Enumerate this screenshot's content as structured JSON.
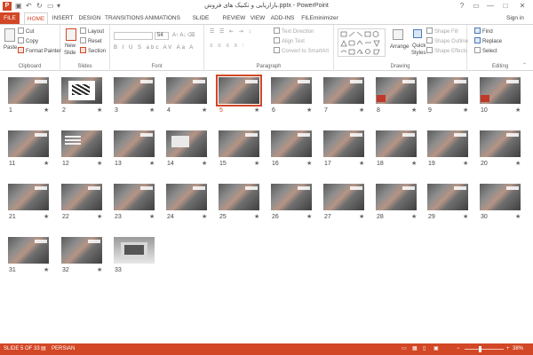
{
  "window": {
    "title": "بازاریابی و تکنیک های فروش.pptx - PowerPoint",
    "app_letter": "P",
    "qat": [
      "save-icon",
      "undo-icon",
      "redo-icon",
      "slideshow-icon",
      "customize-icon"
    ],
    "controls": [
      "?",
      "▭",
      "—",
      "□",
      "✕"
    ]
  },
  "tabs": [
    {
      "label": "FILE"
    },
    {
      "label": "HOME"
    },
    {
      "label": "INSERT"
    },
    {
      "label": "DESIGN"
    },
    {
      "label": "TRANSITIONS"
    },
    {
      "label": "ANIMATIONS"
    },
    {
      "label": "SLIDE SHOW"
    },
    {
      "label": "REVIEW"
    },
    {
      "label": "VIEW"
    },
    {
      "label": "ADD-INS"
    },
    {
      "label": "FILEminimizer"
    }
  ],
  "sign_in": "Sign in",
  "ribbon": {
    "clipboard": {
      "label": "Clipboard",
      "paste": "Paste",
      "cut": "Cut",
      "copy": "Copy",
      "format_painter": "Format Painter"
    },
    "slides": {
      "label": "Slides",
      "new_slide_1": "New",
      "new_slide_2": "Slide",
      "layout": "Layout",
      "reset": "Reset",
      "section": "Section"
    },
    "font": {
      "label": "Font",
      "font_name": "",
      "font_size": "54"
    },
    "paragraph": {
      "label": "Paragraph",
      "text_direction": "Text Direction",
      "align_text": "Align Text",
      "convert_smartart": "Convert to SmartArt"
    },
    "drawing": {
      "label": "Drawing",
      "arrange": "Arrange",
      "quick_styles_1": "Quick",
      "quick_styles_2": "Styles",
      "shape_fill": "Shape Fill",
      "shape_outline": "Shape Outline",
      "shape_effects": "Shape Effects"
    },
    "editing": {
      "label": "Editing",
      "find": "Find",
      "replace": "Replace",
      "select": "Select"
    }
  },
  "slides": [
    {
      "num": "1",
      "star": true,
      "kind": "photo"
    },
    {
      "num": "2",
      "star": true,
      "kind": "ink"
    },
    {
      "num": "3",
      "star": true,
      "kind": "photo"
    },
    {
      "num": "4",
      "star": true,
      "kind": "photo"
    },
    {
      "num": "5",
      "star": true,
      "kind": "photo",
      "selected": true
    },
    {
      "num": "6",
      "star": true,
      "kind": "photo"
    },
    {
      "num": "7",
      "star": true,
      "kind": "photo"
    },
    {
      "num": "8",
      "star": true,
      "kind": "tag"
    },
    {
      "num": "9",
      "star": true,
      "kind": "photo"
    },
    {
      "num": "10",
      "star": true,
      "kind": "tag"
    },
    {
      "num": "11",
      "star": true,
      "kind": "photo"
    },
    {
      "num": "12",
      "star": true,
      "kind": "lines"
    },
    {
      "num": "13",
      "star": true,
      "kind": "photo"
    },
    {
      "num": "14",
      "star": true,
      "kind": "card"
    },
    {
      "num": "15",
      "star": true,
      "kind": "photo"
    },
    {
      "num": "16",
      "star": true,
      "kind": "photo"
    },
    {
      "num": "17",
      "star": true,
      "kind": "photo"
    },
    {
      "num": "18",
      "star": true,
      "kind": "photo"
    },
    {
      "num": "19",
      "star": true,
      "kind": "photo"
    },
    {
      "num": "20",
      "star": true,
      "kind": "photo"
    },
    {
      "num": "21",
      "star": true,
      "kind": "photo"
    },
    {
      "num": "22",
      "star": true,
      "kind": "photo"
    },
    {
      "num": "23",
      "star": true,
      "kind": "photo"
    },
    {
      "num": "24",
      "star": true,
      "kind": "photo"
    },
    {
      "num": "25",
      "star": true,
      "kind": "photo"
    },
    {
      "num": "26",
      "star": true,
      "kind": "photo"
    },
    {
      "num": "27",
      "star": true,
      "kind": "photo"
    },
    {
      "num": "28",
      "star": true,
      "kind": "photo"
    },
    {
      "num": "29",
      "star": true,
      "kind": "photo"
    },
    {
      "num": "30",
      "star": true,
      "kind": "photo"
    },
    {
      "num": "31",
      "star": true,
      "kind": "photo"
    },
    {
      "num": "32",
      "star": true,
      "kind": "photo"
    },
    {
      "num": "33",
      "star": false,
      "kind": "laptop"
    }
  ],
  "star_glyph": "★",
  "status": {
    "slide_of": "SLIDE 5 OF 33",
    "language": "PERSIAN",
    "zoom": "38%",
    "zoom_fraction": 0.38
  },
  "colors": {
    "accent": "#d24726",
    "status_bar": "#d24726"
  }
}
